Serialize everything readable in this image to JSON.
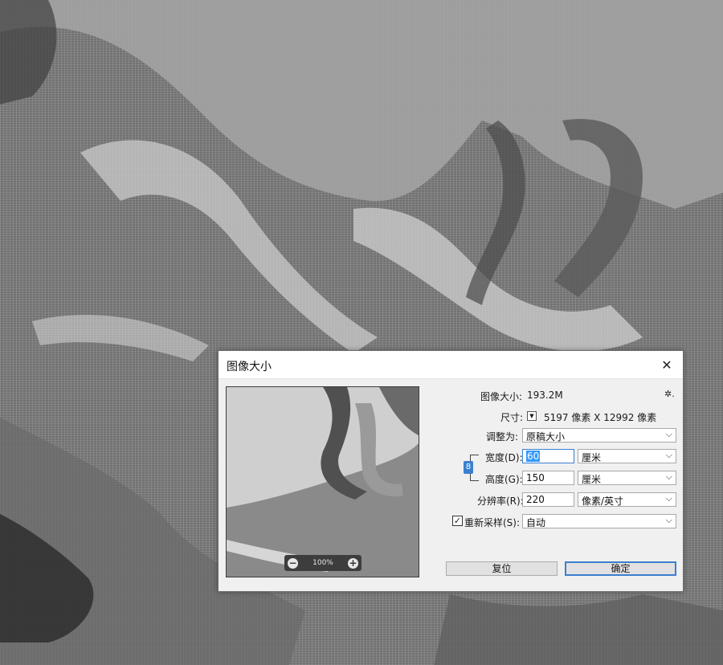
{
  "dialog": {
    "title": "图像大小",
    "close_glyph": "✕",
    "image_size_label": "图像大小:",
    "image_size_value": "193.2M",
    "gear_glyph": "✲.",
    "dimensions_label": "尺寸:",
    "dimensions_value": "5197 像素  X  12992 像素",
    "fit_to_label": "调整为:",
    "fit_to_value": "原稿大小",
    "width_label": "宽度(D):",
    "width_value": "60",
    "width_unit": "厘米",
    "height_label": "高度(G):",
    "height_value": "150",
    "height_unit": "厘米",
    "resolution_label": "分辨率(R):",
    "resolution_value": "220",
    "resolution_unit": "像素/英寸",
    "resample_label": "重新采样(S):",
    "resample_checked": true,
    "resample_value": "自动",
    "reset_button": "复位",
    "ok_button": "确定",
    "zoom_level": "100%",
    "zoom_out_glyph": "−",
    "zoom_in_glyph": "+",
    "chevron_glyph": "⌵",
    "check_glyph": "✓",
    "link_glyph": "8",
    "dropdown_glyph": "▼"
  },
  "icons": {
    "close": "close-icon",
    "gear": "gear-icon",
    "link": "link-icon",
    "zoom_in": "zoom-in-icon",
    "zoom_out": "zoom-out-icon"
  },
  "colors": {
    "accent": "#3b7fd0",
    "selection": "#3399ff"
  }
}
